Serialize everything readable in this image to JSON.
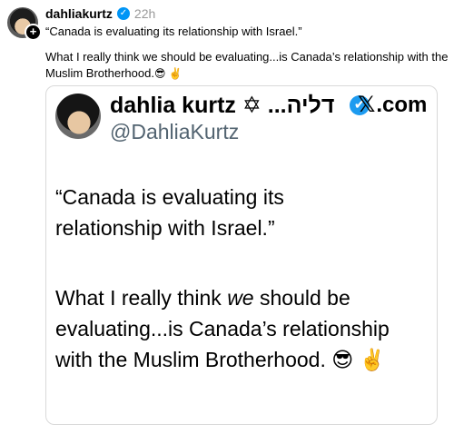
{
  "post": {
    "username": "dahliakurtz",
    "verified_icon": "verified-check-icon",
    "timestamp": "22h",
    "quote_line": "“Canada is evaluating its relationship with Israel.”",
    "caption": "What I really think we should be evaluating...is Canada’s relationship with the Muslim Brotherhood.",
    "caption_emojis": "😎 ✌️",
    "follow_symbol": "+"
  },
  "embed": {
    "name": "dahlia kurtz ✡ ...דליה",
    "handle": "@DahliaKurtz",
    "site_glyph": "𝕏",
    "site_text": ".com",
    "verified_symbol": "✔",
    "text1": "“Canada is evaluating its relationship with Israel.”",
    "text2_part1": "What I really think ",
    "text2_italic": "we",
    "text2_part2": " should be evaluating...is Canada’s relationship with the Muslim Brotherhood. ",
    "text2_emojis": "😎 ✌️"
  }
}
